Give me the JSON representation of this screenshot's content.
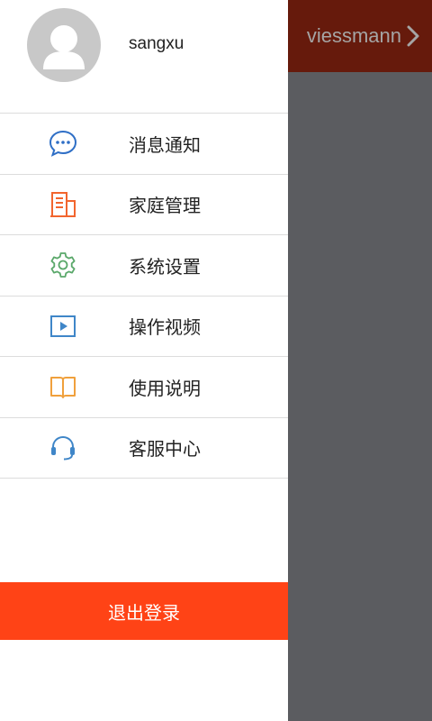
{
  "background": {
    "brand_title": "viessmann",
    "header_color": "#661a0c",
    "overlay_color": "#5b5c60"
  },
  "drawer": {
    "user": {
      "name": "sangxu",
      "avatar_icon": "user-avatar-icon"
    },
    "menu_items": [
      {
        "label": "消息通知",
        "icon": "chat-bubble-icon",
        "color": "#2f6fc6"
      },
      {
        "label": "家庭管理",
        "icon": "building-icon",
        "color": "#f2652e"
      },
      {
        "label": "系统设置",
        "icon": "gear-icon",
        "color": "#5aa86a"
      },
      {
        "label": "操作视频",
        "icon": "video-play-icon",
        "color": "#3f86c8"
      },
      {
        "label": "使用说明",
        "icon": "book-icon",
        "color": "#f0a03c"
      },
      {
        "label": "客服中心",
        "icon": "headset-icon",
        "color": "#3f86c8"
      }
    ],
    "logout_label": "退出登录",
    "logout_color": "#ff4316"
  }
}
